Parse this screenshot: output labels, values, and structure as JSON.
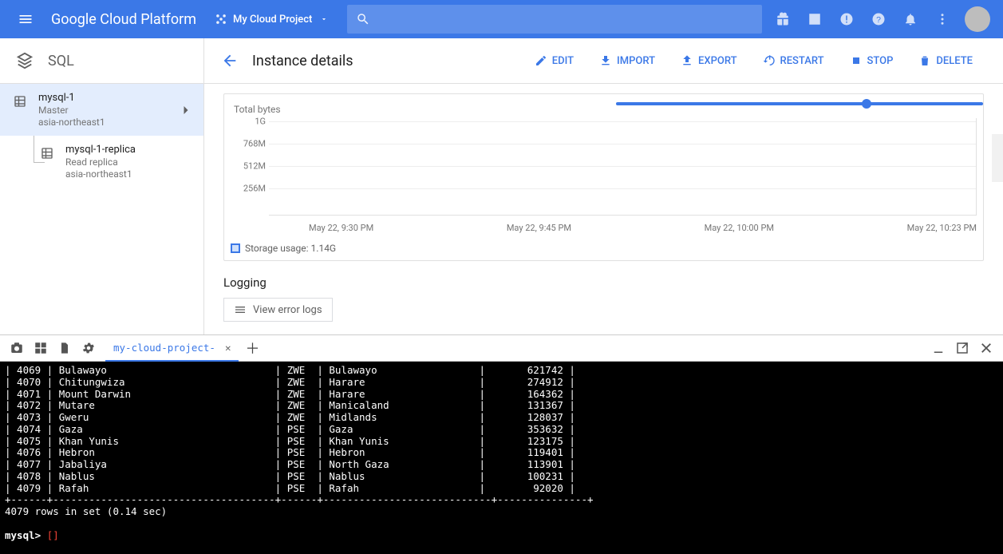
{
  "header": {
    "logo_a": "Google",
    "logo_b": "Cloud Platform",
    "project_name": "My Cloud Project",
    "search_placeholder": ""
  },
  "sidenav": {
    "title": "SQL",
    "instances": [
      {
        "name": "mysql-1",
        "role": "Master",
        "region": "asia-northeast1",
        "active": true
      },
      {
        "name": "mysql-1-replica",
        "role": "Read replica",
        "region": "asia-northeast1",
        "active": false
      }
    ]
  },
  "toolbar": {
    "title": "Instance details",
    "actions": {
      "edit": "EDIT",
      "import": "IMPORT",
      "export": "EXPORT",
      "restart": "RESTART",
      "stop": "STOP",
      "delete": "DELETE"
    }
  },
  "chart_data": {
    "type": "line",
    "title": "Total bytes",
    "ylabels": [
      "1G",
      "768M",
      "512M",
      "256M"
    ],
    "xlabels": [
      "May 22, 9:30 PM",
      "May 22, 9:45 PM",
      "May 22, 10:00 PM",
      "May 22, 10:23 PM"
    ],
    "legend": "Storage usage: 1.14G"
  },
  "logging": {
    "title": "Logging",
    "button": "View error logs"
  },
  "terminal": {
    "tab_label": "my-cloud-project-",
    "rows": [
      {
        "id": "4069",
        "city": "Bulawayo",
        "cc": "ZWE",
        "district": "Bulawayo",
        "pop": "621742"
      },
      {
        "id": "4070",
        "city": "Chitungwiza",
        "cc": "ZWE",
        "district": "Harare",
        "pop": "274912"
      },
      {
        "id": "4071",
        "city": "Mount Darwin",
        "cc": "ZWE",
        "district": "Harare",
        "pop": "164362"
      },
      {
        "id": "4072",
        "city": "Mutare",
        "cc": "ZWE",
        "district": "Manicaland",
        "pop": "131367"
      },
      {
        "id": "4073",
        "city": "Gweru",
        "cc": "ZWE",
        "district": "Midlands",
        "pop": "128037"
      },
      {
        "id": "4074",
        "city": "Gaza",
        "cc": "PSE",
        "district": "Gaza",
        "pop": "353632"
      },
      {
        "id": "4075",
        "city": "Khan Yunis",
        "cc": "PSE",
        "district": "Khan Yunis",
        "pop": "123175"
      },
      {
        "id": "4076",
        "city": "Hebron",
        "cc": "PSE",
        "district": "Hebron",
        "pop": "119401"
      },
      {
        "id": "4077",
        "city": "Jabaliya",
        "cc": "PSE",
        "district": "North Gaza",
        "pop": "113901"
      },
      {
        "id": "4078",
        "city": "Nablus",
        "cc": "PSE",
        "district": "Nablus",
        "pop": "100231"
      },
      {
        "id": "4079",
        "city": "Rafah",
        "cc": "PSE",
        "district": "Rafah",
        "pop": "92020"
      }
    ],
    "separator": "+------+-------------------------------------+------+----------------------------+---------------+",
    "summary": "4079 rows in set (0.14 sec)",
    "prompt": "mysql>",
    "cursor": "[]"
  }
}
